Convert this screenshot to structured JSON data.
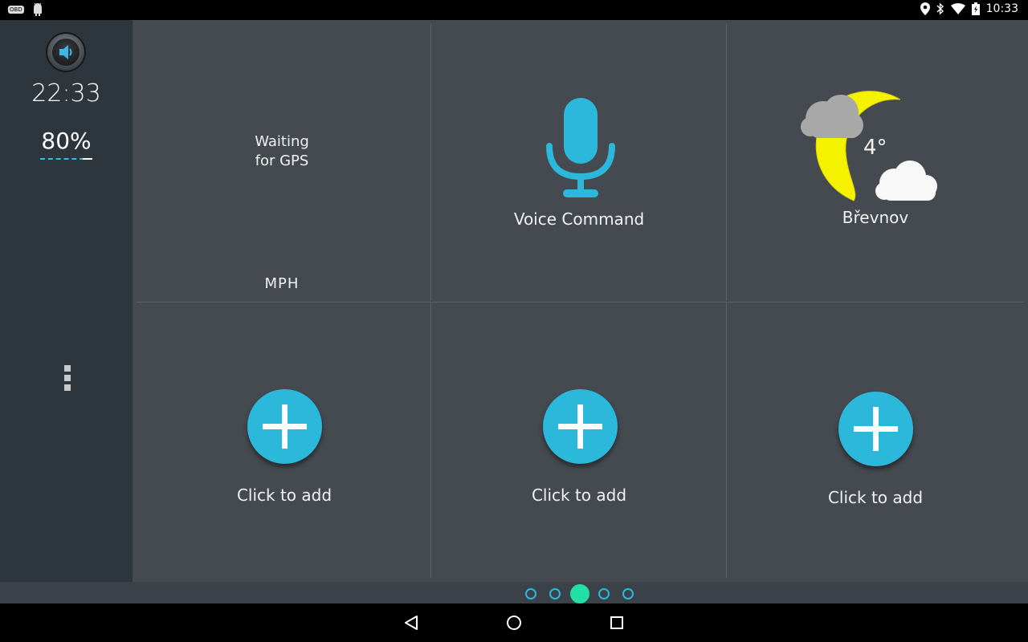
{
  "status_bar": {
    "obd_label": "OBD",
    "time": "10:33",
    "icons": [
      "android-icon",
      "location-icon",
      "bluetooth-icon",
      "wifi-icon",
      "battery-icon"
    ]
  },
  "sidebar": {
    "clock": "22:33",
    "battery": "80%",
    "speaker_icon": "speaker-icon",
    "menu_icon": "more-vert-icon"
  },
  "tiles": {
    "gps": {
      "status": "Waiting\nfor GPS",
      "unit": "MPH"
    },
    "voice": {
      "label": "Voice Command",
      "icon": "microphone-icon"
    },
    "weather": {
      "temperature": "4°",
      "location": "Břevnov",
      "icon": "night-cloudy-icon"
    },
    "add": [
      {
        "label": "Click to add"
      },
      {
        "label": "Click to add"
      },
      {
        "label": "Click to add"
      }
    ]
  },
  "pager": {
    "pages": 5,
    "active": 3
  },
  "colors": {
    "accent": "#2cb8da",
    "active_dot": "#22dfa6",
    "sidebar_bg": "#2e363d",
    "tile_bg": "#454a51",
    "moon": "#f5f200"
  },
  "nav_bar": {
    "icons": [
      "back-icon",
      "home-icon",
      "recents-icon"
    ]
  }
}
